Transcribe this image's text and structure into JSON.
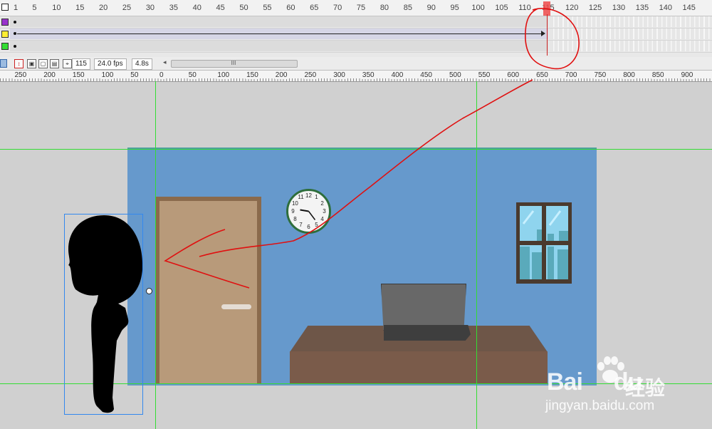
{
  "timeline": {
    "frame_numbers": [
      "1",
      "5",
      "10",
      "15",
      "20",
      "25",
      "30",
      "35",
      "40",
      "45",
      "50",
      "55",
      "60",
      "65",
      "70",
      "75",
      "80",
      "85",
      "90",
      "95",
      "100",
      "105",
      "110",
      "115",
      "120",
      "125",
      "130",
      "135",
      "140",
      "145"
    ],
    "layers": [
      {
        "color": "#9933cc",
        "type": "keyframe"
      },
      {
        "color": "#ffee33",
        "type": "motion-tween"
      },
      {
        "color": "#33dd33",
        "type": "keyframe"
      }
    ],
    "current_frame": "115",
    "fps": "24.0 fps",
    "elapsed": "4.8s",
    "scroll_thumb_label": "III"
  },
  "stage_ruler": {
    "labels": [
      "250",
      "200",
      "150",
      "100",
      "50",
      "0",
      "50",
      "100",
      "150",
      "200",
      "250",
      "300",
      "350",
      "400",
      "450",
      "500",
      "550",
      "600",
      "650",
      "700",
      "750",
      "800",
      "850",
      "900"
    ]
  },
  "clock": {
    "numbers": [
      "12",
      "1",
      "2",
      "3",
      "4",
      "5",
      "6",
      "7",
      "8",
      "9",
      "10",
      "11"
    ]
  },
  "watermark": {
    "logo_text": "Bai",
    "logo_suffix": "du",
    "cn_text": "经验",
    "url": "jingyan.baidu.com"
  },
  "colors": {
    "stage_bg": "#6699cc",
    "guide": "#33dd33",
    "annotation": "#e01010",
    "selection": "#3388ee"
  }
}
